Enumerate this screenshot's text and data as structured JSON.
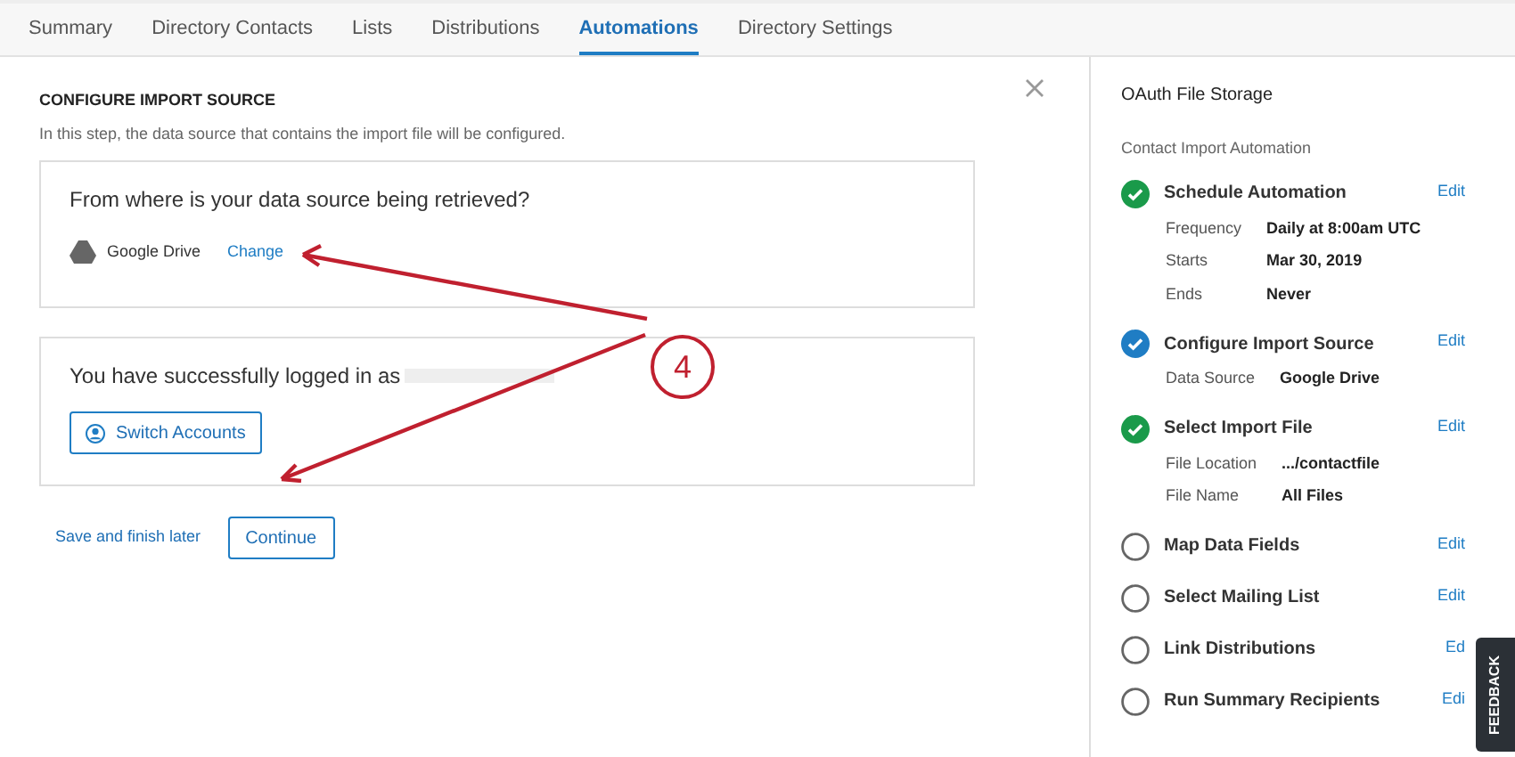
{
  "tabs": [
    {
      "label": "Summary",
      "selected": false
    },
    {
      "label": "Directory Contacts",
      "selected": false
    },
    {
      "label": "Lists",
      "selected": false
    },
    {
      "label": "Distributions",
      "selected": false
    },
    {
      "label": "Automations",
      "selected": true
    },
    {
      "label": "Directory Settings",
      "selected": false
    }
  ],
  "main": {
    "title": "CONFIGURE IMPORT SOURCE",
    "description": "In this step, the data source that contains the import file will be configured.",
    "source_card": {
      "question": "From where is your data source being retrieved?",
      "source": "Google Drive",
      "change_link": "Change"
    },
    "login_card": {
      "message": "You have successfully logged in as",
      "switch_button": "Switch Accounts"
    },
    "save_link": "Save and finish later",
    "continue_button": "Continue"
  },
  "annotation": {
    "label": "4"
  },
  "sidebar": {
    "title": "OAuth File Storage",
    "subtitle": "Contact Import Automation",
    "steps": [
      {
        "kind": "complete",
        "name": "Schedule Automation",
        "edit": "Edit",
        "details": [
          {
            "label": "Frequency",
            "value": "Daily at 8:00am UTC"
          },
          {
            "label": "Starts",
            "value": "Mar 30, 2019"
          },
          {
            "label": "Ends",
            "value": "Never"
          }
        ]
      },
      {
        "kind": "current",
        "name": "Configure Import Source",
        "edit": "Edit",
        "details": [
          {
            "label": "Data Source",
            "value": "Google Drive"
          }
        ]
      },
      {
        "kind": "complete",
        "name": "Select Import File",
        "edit": "Edit",
        "details": [
          {
            "label": "File Location",
            "value": ".../contactfile"
          },
          {
            "label": "File Name",
            "value": "All Files"
          }
        ]
      },
      {
        "kind": "pending",
        "name": "Map Data Fields",
        "edit": "Edit"
      },
      {
        "kind": "pending",
        "name": "Select Mailing List",
        "edit": "Edit"
      },
      {
        "kind": "pending",
        "name": "Link Distributions",
        "edit": "Ed"
      },
      {
        "kind": "pending",
        "name": "Run Summary Recipients",
        "edit": "Edi"
      }
    ]
  },
  "feedback_tab": "FEEDBACK"
}
